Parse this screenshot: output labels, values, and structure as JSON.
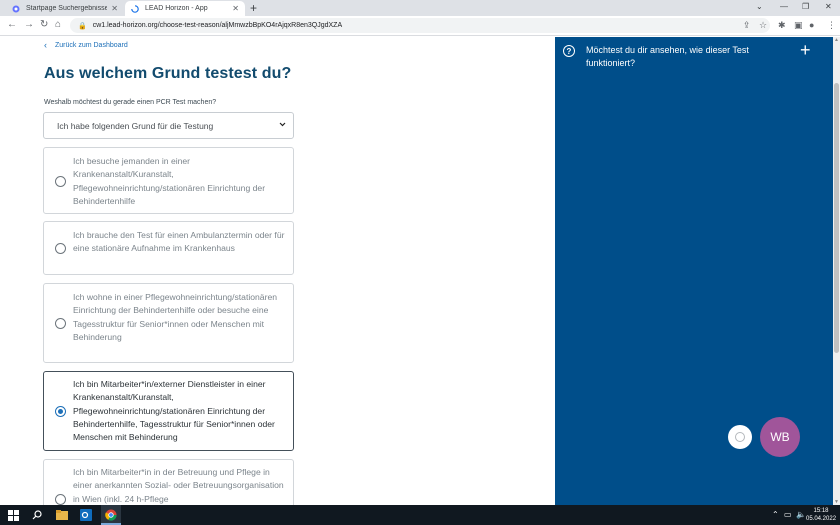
{
  "browser": {
    "tabs": [
      {
        "title": "Startpage Suchergebnisse"
      },
      {
        "title": "LEAD Horizon - App"
      }
    ],
    "url": "cw1.lead-horizon.org/choose-test-reason/aljMmwzbBpKO4rAjqxR8en3QJgdXZA"
  },
  "page": {
    "back_label": "Zurück zum Dashboard",
    "heading": "Aus welchem Grund testest du?",
    "question": "Weshalb möchtest du gerade einen PCR Test machen?",
    "select_value": "Ich habe folgenden Grund für die Testung",
    "options": [
      {
        "label": "Ich besuche jemanden in einer Krankenanstalt/Kuranstalt, Pflegewohneinrichtung/stationären Einrichtung der Behindertenhilfe"
      },
      {
        "label": "Ich brauche den Test für einen Ambulanztermin oder für eine stationäre Aufnahme im Krankenhaus"
      },
      {
        "label": "Ich wohne in einer Pflegewohneinrichtung/stationären Einrichtung der Behindertenhilfe oder besuche eine Tagesstruktur für Senior*innen oder Menschen mit Behinderung"
      },
      {
        "label": "Ich bin Mitarbeiter*in/externer Dienstleister in einer Krankenanstalt/Kuranstalt, Pflegewohneinrichtung/stationären Einrichtung der Behindertenhilfe, Tagesstruktur für Senior*innen oder Menschen mit Behinderung"
      },
      {
        "label": "Ich bin Mitarbeiter*in in der Betreuung und Pflege in einer anerkannten Sozial- oder Betreuungsorganisation in Wien (inkl. 24 h-Pflege"
      }
    ],
    "selected_index": 3
  },
  "panel": {
    "title": "Möchtest du dir ansehen, wie dieser Test funktioniert?",
    "avatar_initials": "WB"
  },
  "taskbar": {
    "time": "15:18",
    "date": "05.04.2022"
  },
  "colors": {
    "brand_blue": "#004e8a",
    "heading": "#124b6e",
    "link": "#1c6fb8",
    "avatar": "#a0559a"
  }
}
